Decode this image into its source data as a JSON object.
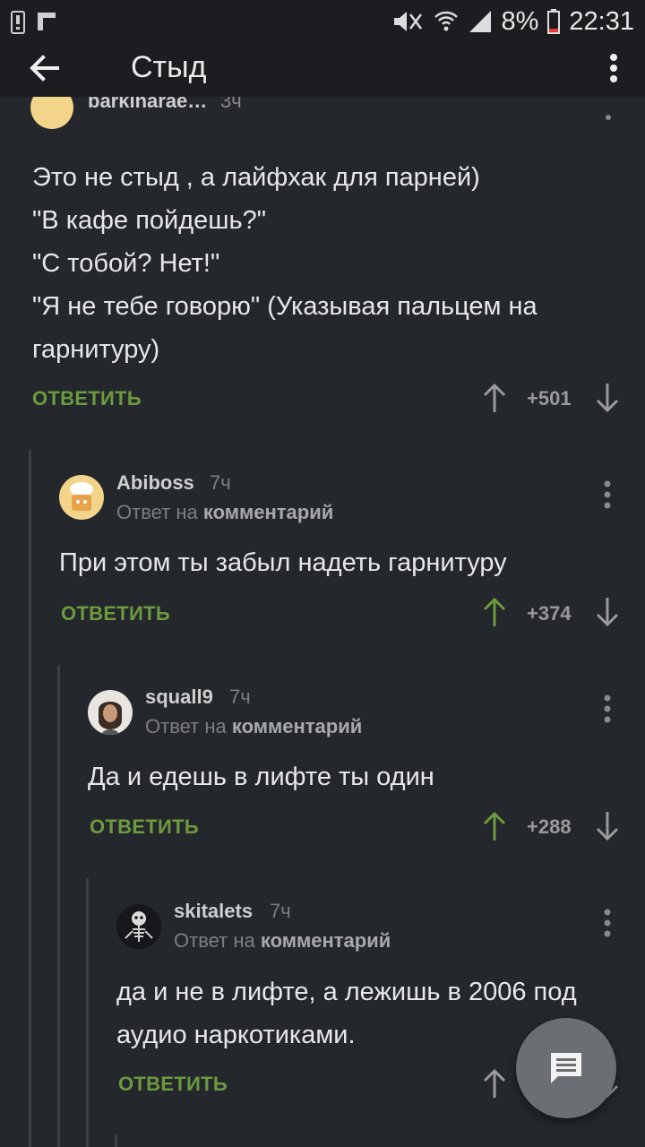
{
  "status_bar": {
    "battery": "8%",
    "time": "22:31"
  },
  "app_bar": {
    "title": "Стыд"
  },
  "partial_comment": {
    "author": "barkinarae…",
    "time": "3ч"
  },
  "comments": [
    {
      "text": "Это не стыд , а лайфхак для парней)\n\"В кафе пойдешь?\"\n\"С тобой? Нет!\"\n\"Я не тебе говорю\" (Указывая пальцем на гарнитуру)",
      "reply_label": "ОТВЕТИТЬ",
      "score": "+501",
      "upvoted": false
    },
    {
      "author": "Abiboss",
      "time": "7ч",
      "reply_prefix": "Ответ на",
      "reply_target": "комментарий",
      "text": "При этом ты забыл надеть гарнитуру",
      "reply_label": "ОТВЕТИТЬ",
      "score": "+374",
      "upvoted": true
    },
    {
      "author": "squall9",
      "time": "7ч",
      "reply_prefix": "Ответ на",
      "reply_target": "комментарий",
      "text": "Да и едешь в лифте ты один",
      "reply_label": "ОТВЕТИТЬ",
      "score": "+288",
      "upvoted": true
    },
    {
      "author": "skitalets",
      "time": "7ч",
      "reply_prefix": "Ответ на",
      "reply_target": "комментарий",
      "text": "да и не в лифте, а лежишь в 2006 под аудио наркотиками.",
      "reply_label": "ОТВЕТИТЬ",
      "score": "",
      "upvoted": false
    }
  ],
  "colors": {
    "background": "#24272b",
    "bar": "#1b1d20",
    "accent_green": "#6d9a3f",
    "score_gray": "#9a9a9a"
  },
  "icons": [
    "back-arrow-icon",
    "more-vert-icon",
    "upvote-arrow-icon",
    "downvote-arrow-icon",
    "comment-fab-icon"
  ]
}
